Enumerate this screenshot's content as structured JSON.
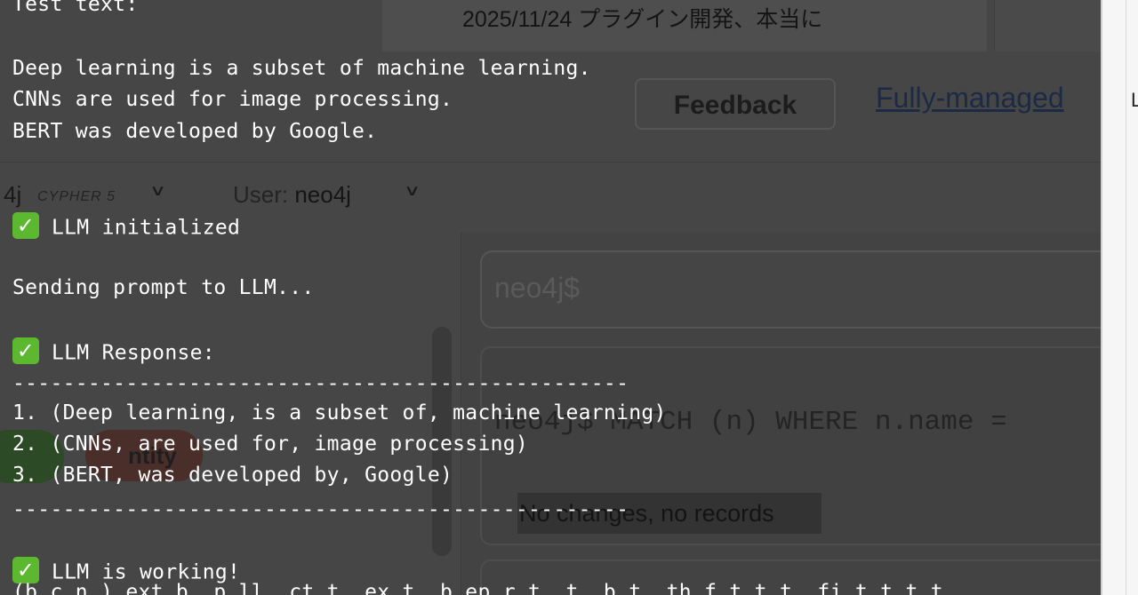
{
  "background": {
    "date_text": "2025/11/24  プラグイン開発、本当に",
    "feedback_label": "Feedback",
    "fully_managed_label": "Fully-managed",
    "db_label": "4j",
    "cypher_label": "CYPHER 5",
    "user_prefix": "User: ",
    "user_name": "neo4j",
    "prompt_placeholder": "neo4j$",
    "query_text": "neo4j$ MATCH (n) WHERE n.name =",
    "result_text": "No changes, no records",
    "pill_text": "ntity",
    "edge_glyph": "L"
  },
  "terminal": {
    "line_cut": "Test text:",
    "line_1": "Deep learning is a subset of machine learning.",
    "line_2": "CNNs are used for image processing.",
    "line_3": "BERT was developed by Google.",
    "status_initialized": "LLM initialized",
    "sending": "Sending prompt to LLM...",
    "response_header": "LLM Response:",
    "divider": "-------------------------------------------------",
    "triples": [
      "1. (Deep learning, is a subset of, machine learning)",
      "2. (CNNs, are used for, image processing)",
      "3. (BERT, was developed by, Google)"
    ],
    "status_working": "LLM is working!",
    "line_bottom": "(b_c_n_) ext b_ p_ll_ ct_t_ ex_t_ b ep_r_t_ t_ b_t_ th f_t_t_t_ fi_t_t_t_t"
  },
  "icons": {
    "check": "check-mark-icon",
    "chevron": "chevron-down-icon"
  },
  "colors": {
    "check_bg": "#5cb82f",
    "terminal_text": "#ffffff"
  }
}
